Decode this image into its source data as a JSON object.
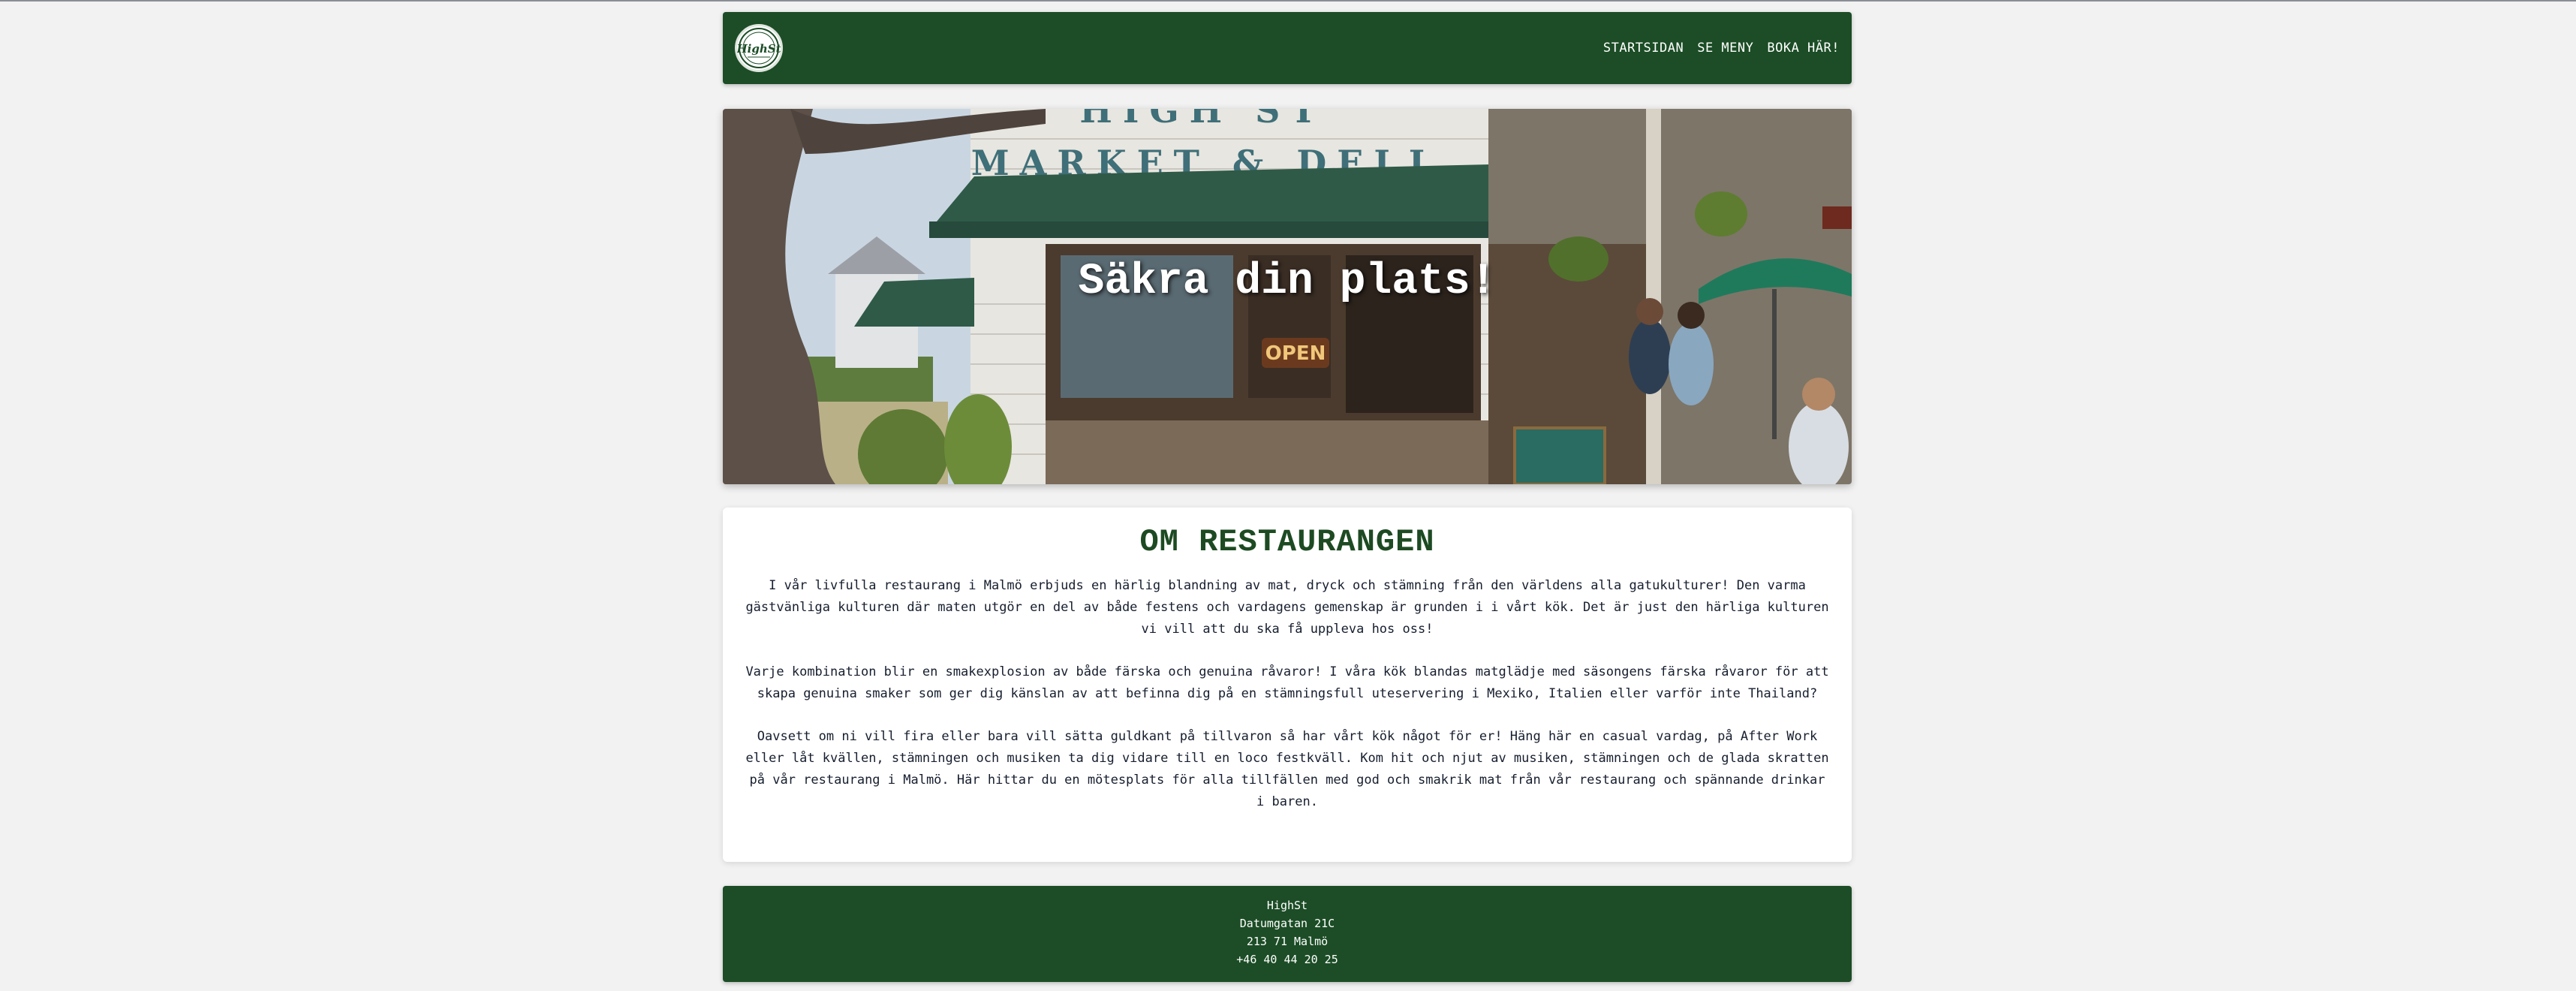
{
  "colors": {
    "brand_green": "#1c4d26",
    "heading_green": "#1d4a22",
    "page_background": "#f2f2f2"
  },
  "header": {
    "logo_text": "HighSt",
    "logo_icon": "highst-logo-icon",
    "nav": [
      {
        "label": "STARTSIDAN"
      },
      {
        "label": "SE MENY"
      },
      {
        "label": "BOKA HÄR!"
      }
    ]
  },
  "hero": {
    "title": "Säkra din plats!",
    "sign_text": "MARKET & DELI",
    "open_sign": "OPEN"
  },
  "about": {
    "heading": "OM RESTAURANGEN",
    "paragraphs": [
      "I vår livfulla restaurang i Malmö erbjuds en härlig blandning av mat, dryck och stämning från den världens alla gatukulturer! Den varma gästvänliga kulturen där maten utgör en del av både festens och vardagens gemenskap är grunden i i vårt kök. Det är just den härliga kulturen vi vill att du ska få uppleva hos oss!",
      "Varje kombination blir en smakexplosion av både färska och genuina råvaror! I våra kök blandas matglädje med säsongens färska råvaror för att skapa genuina smaker som ger dig känslan av att befinna dig på en stämningsfull uteservering i Mexiko, Italien eller varför inte Thailand?",
      "Oavsett om ni vill fira eller bara vill sätta guldkant på tillvaron så har vårt kök något för er! Häng här en casual vardag, på After Work eller låt kvällen, stämningen och musiken ta dig vidare till en loco festkväll. Kom hit och njut av musiken, stämningen och de glada skratten på vår restaurang i Malmö. Här hittar du en mötesplats för alla tillfällen med god och smakrik mat från vår restaurang och spännande drinkar i baren."
    ]
  },
  "footer": {
    "name": "HighSt",
    "street": "Datumgatan 21C",
    "city": "213 71 Malmö",
    "phone": "+46 40 44 20 25"
  }
}
